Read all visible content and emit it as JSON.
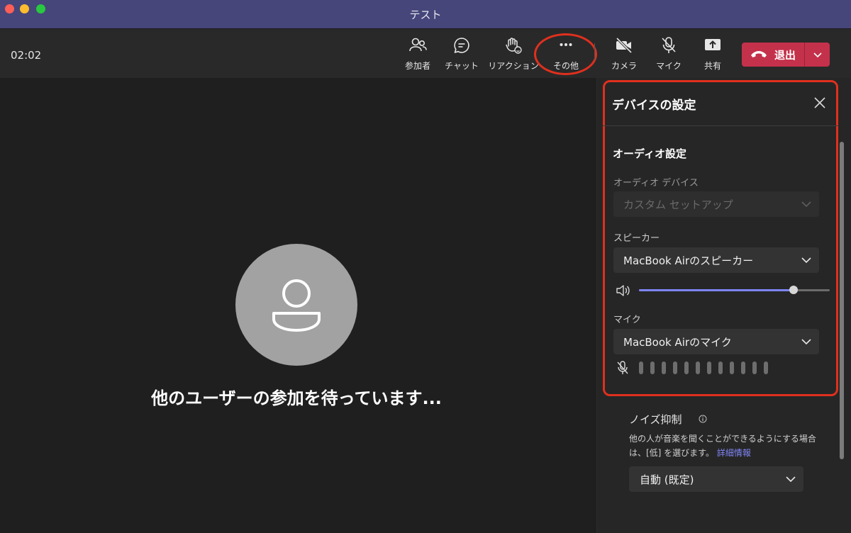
{
  "window": {
    "title": "テスト"
  },
  "toolbar": {
    "timer": "02:02",
    "buttons": {
      "participants": "参加者",
      "chat": "チャット",
      "reactions": "リアクション",
      "more": "その他",
      "camera": "カメラ",
      "mic": "マイク",
      "share": "共有"
    },
    "leave_label": "退出"
  },
  "stage": {
    "waiting_text": "他のユーザーの参加を待っています..."
  },
  "panel": {
    "title": "デバイスの設定",
    "audio_section": "オーディオ設定",
    "audio_device_label": "オーディオ デバイス",
    "audio_device_value": "カスタム セットアップ",
    "speaker_label": "スピーカー",
    "speaker_value": "MacBook Airのスピーカー",
    "speaker_volume": 0.81,
    "mic_label": "マイク",
    "mic_value": "MacBook Airのマイク",
    "noise_label": "ノイズ抑制",
    "noise_desc": "他の人が音楽を聞くことができるようにする場合は、[低] を選びます。",
    "noise_link": "詳細情報",
    "noise_value": "自動 (既定)"
  },
  "colors": {
    "accent": "#7f85f5",
    "leave": "#c4314b",
    "titlebar": "#46467a",
    "highlight": "#e0301e"
  }
}
